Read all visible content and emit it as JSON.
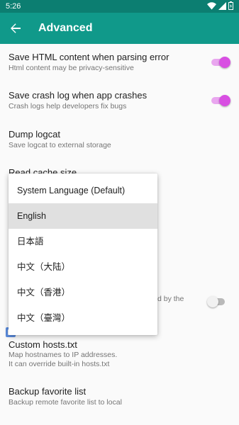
{
  "status_bar": {
    "time": "5:26"
  },
  "toolbar": {
    "title": "Advanced"
  },
  "settings": {
    "save_html": {
      "title": "Save HTML content when parsing error",
      "summary": "Html content may be privacy-sensitive",
      "enabled": true
    },
    "save_crash": {
      "title": "Save crash log when app crashes",
      "summary": "Crash logs help developers fix bugs",
      "enabled": true
    },
    "dump_logcat": {
      "title": "Dump logcat",
      "summary": "Save logcat to external storage"
    },
    "read_cache": {
      "title": "Read cache size"
    },
    "partial_summary": {
      "text": "d by the"
    },
    "partial_switch": {
      "enabled": false
    },
    "custom_hosts": {
      "title": "Custom hosts.txt",
      "summary_line1": "Map hostnames to IP addresses.",
      "summary_line2": "It can override built-in hosts.txt"
    },
    "backup_favorites": {
      "title": "Backup favorite list",
      "summary": "Backup remote favorite list to local"
    }
  },
  "language_popup": {
    "selected": "English",
    "options": [
      "System Language (Default)",
      "English",
      "日本語",
      "中文（大陆）",
      "中文（香港）",
      "中文（臺灣）"
    ]
  },
  "colors": {
    "toolbar": "#10998a",
    "status_bar": "#0c7e71",
    "switch_on": "#d84fe2"
  }
}
